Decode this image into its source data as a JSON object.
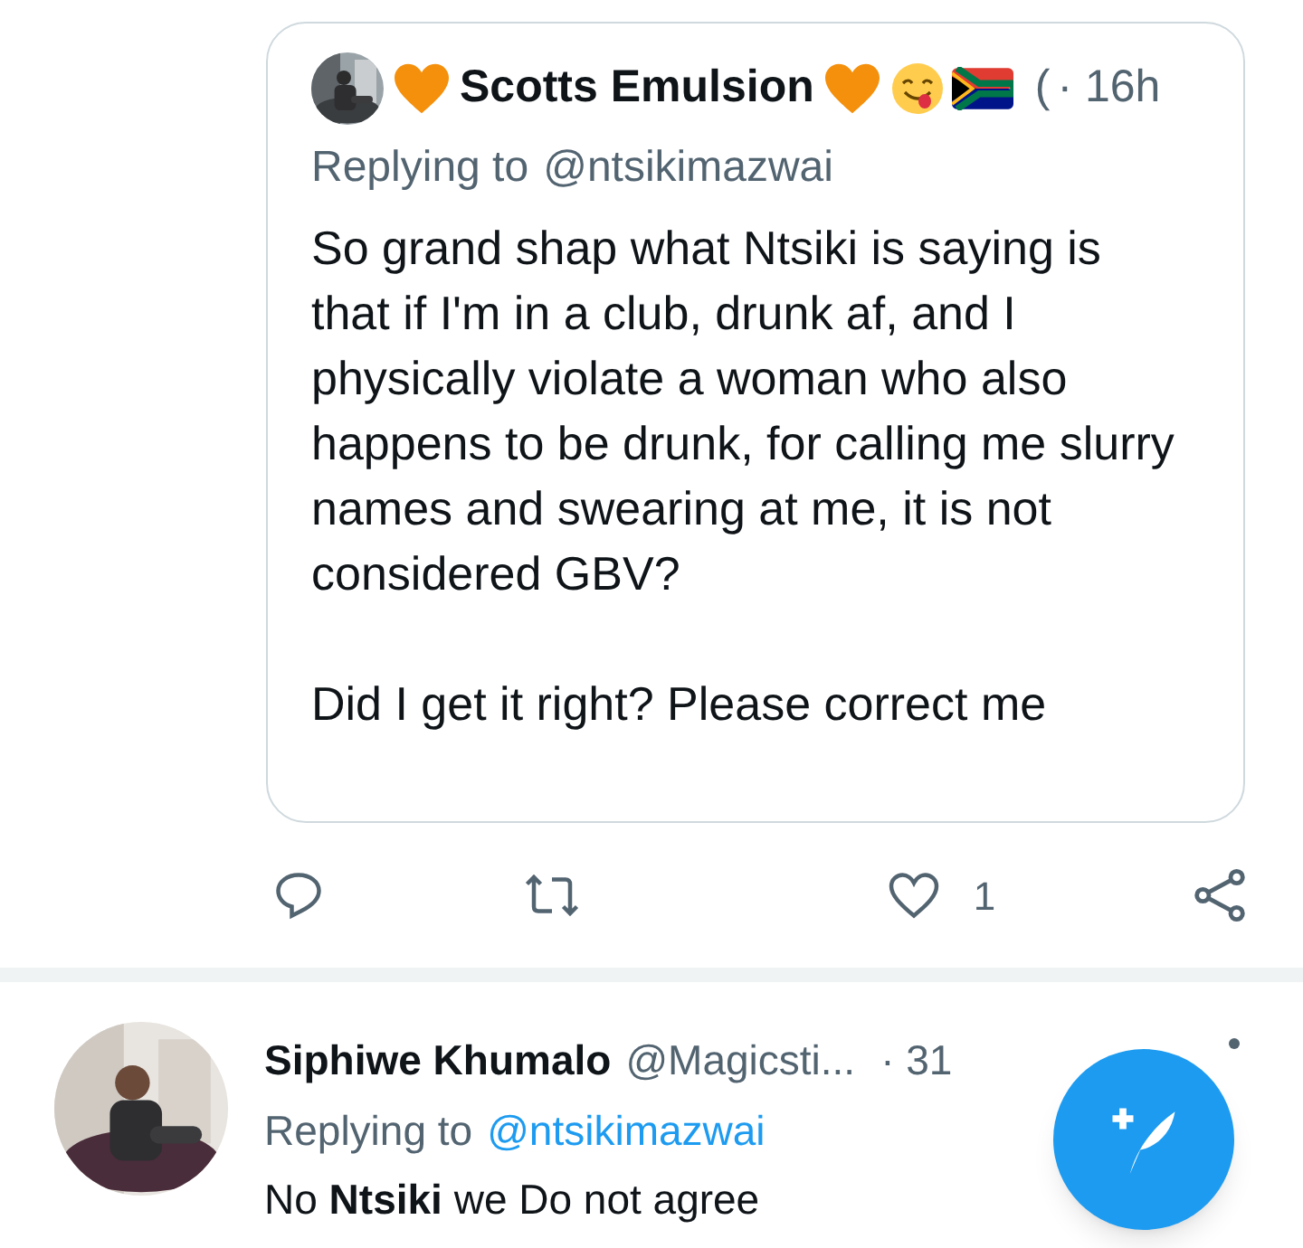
{
  "quoted_tweet": {
    "name": "Scotts Emulsion",
    "cut_mark": "(",
    "time": "· 16h",
    "replying_prefix": "Replying to",
    "replying_handle": "@ntsikimazwai",
    "paragraphs": [
      "So grand shap what Ntsiki is saying is that if I'm in a club, drunk af, and I physically violate a woman who also happens to be drunk, for calling me slurry names and swearing at me, it is not considered GBV?",
      "Did I get it right? Please correct me"
    ]
  },
  "actions": {
    "like_count": "1"
  },
  "reply": {
    "name": "Siphiwe Khumalo",
    "handle": "@Magicsti...",
    "time": "· 31",
    "replying_prefix": "Replying to",
    "replying_handle": "@ntsikimazwai",
    "text": "No **Ntsiki** we Do not agree"
  }
}
